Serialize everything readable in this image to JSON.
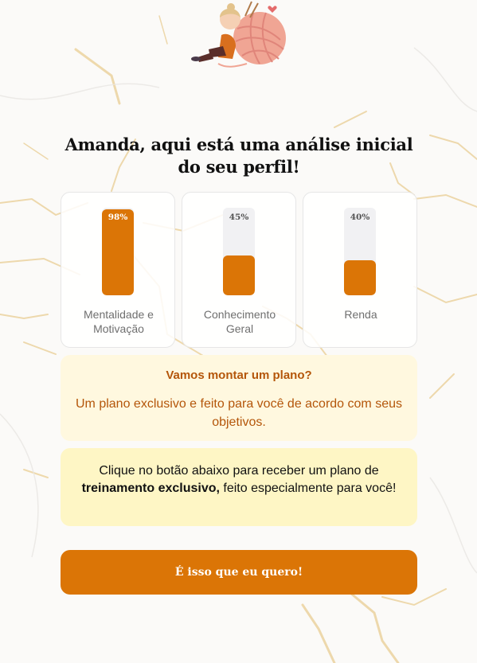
{
  "headline": {
    "line1": "Amanda, aqui está uma análise inicial",
    "line2": "do seu perfil!"
  },
  "stats": [
    {
      "percent_label": "98%",
      "value": 0.98,
      "label": "Mentalidade e Motivação"
    },
    {
      "percent_label": "45%",
      "value": 0.45,
      "label": "Conhecimento Geral"
    },
    {
      "percent_label": "40%",
      "value": 0.4,
      "label": "Renda"
    }
  ],
  "plan_box": {
    "title": "Vamos montar um plano?",
    "text": "Um plano exclusivo e feito para você de acordo com seus objetivos."
  },
  "info_box": {
    "text_before": "Clique no botão abaixo para receber um plano de ",
    "text_bold": "treinamento exclusivo,",
    "text_after": " feito especialmente para você!"
  },
  "cta": {
    "label": "É isso que eu quero!"
  },
  "colors": {
    "accent": "#db7506",
    "plan_bg": "#fff8df",
    "plan_text": "#b4560a",
    "info_bg": "#fef6c5",
    "bar_track": "#f1f1f3"
  },
  "illustration": {
    "icon": "girl-with-yarn-ball-illustration"
  }
}
